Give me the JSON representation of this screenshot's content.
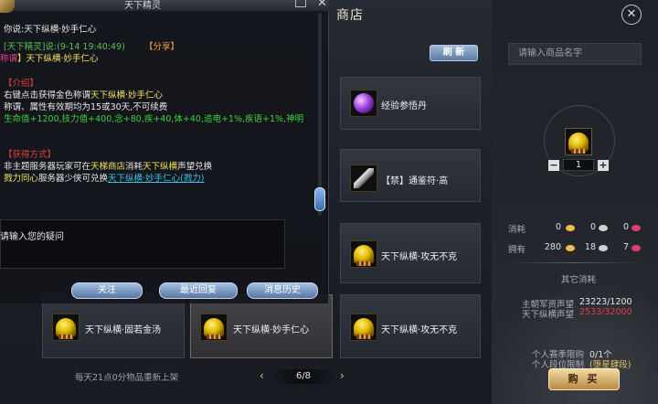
{
  "shop": {
    "title": "商店",
    "close_icon": "close-circle-icon",
    "refresh_label": "刷 新",
    "search_placeholder": "请输入商品名字",
    "footer_note": "每天21点0分物品重新上架",
    "page_indicator": "6/8"
  },
  "items_right": [
    {
      "name": "经验参悟丹",
      "icon": "purple-orb-icon"
    },
    {
      "name": "【禁】通鉴符·高",
      "icon": "feather-icon"
    },
    {
      "name": "天下纵横·攻无不克",
      "icon": "gold-helmet-icon"
    },
    {
      "name": "天下纵横·攻无不克",
      "icon": "gold-helmet-icon"
    }
  ],
  "items_bottom": [
    {
      "name": "天下纵横·固若金汤",
      "icon": "gold-helmet-icon"
    },
    {
      "name": "天下纵横·妙手仁心",
      "icon": "gold-helmet-icon",
      "selected": true
    }
  ],
  "chat": {
    "title": "天下精灵",
    "line_said": "你说:天下纵横·妙手仁心",
    "sender": "[天下精灵]说:(9-14 19:40:49)",
    "share": "【分享】",
    "title_prefix": "称谓",
    "title_item": "】天下纵横·妙手仁心",
    "intro_header": "【介绍】",
    "intro_1_a": "右键点击获得金色称谓",
    "intro_1_b": "天下纵横·妙手仁心",
    "intro_2": "称谓、属性有效期均为15或30天,不可续费",
    "intro_3": "生命值+1200,技力值+400,念+80,疾+40,体+40,追电+1%,疾语+1%,神明",
    "acquire_header": "【获得方式】",
    "acquire_1_a": "非主题服务器玩家可在",
    "acquire_1_b": "天梯商店",
    "acquire_1_c": "消耗",
    "acquire_1_d": "天下纵横",
    "acquire_1_e": "声望兑换",
    "acquire_2_a": "戮力同心",
    "acquire_2_b": "服务器少侠可兑换",
    "acquire_2_c": "天下纵横·妙手仁心(戮力)",
    "input_text": "请输入您的疑问",
    "btn_follow": "关注",
    "btn_recent": "最近回复",
    "btn_history": "消息历史"
  },
  "purchase": {
    "quantity": "1",
    "cost_label": "消耗",
    "cost_values": [
      "0",
      "0",
      "0"
    ],
    "own_label": "拥有",
    "own_values": [
      "280",
      "18",
      "7"
    ],
    "other_cost_header": "其它消耗",
    "rep1_label": "主朝军资声望",
    "rep1_value": "23223/1200",
    "rep2_label": "天下纵横声望",
    "rep2_value": "2533/32000",
    "season_limit_label": "个人赛季限购",
    "season_limit_value": "0/1个",
    "rank_limit_label": "个人段位限制",
    "rank_limit_value": "(堕星肆段)",
    "buy_label": "购 买",
    "colors": {
      "rep2_value": "#e04040",
      "rep1_value": "#e6e6e6",
      "coin_gold": "#e8c24a",
      "coin_silver": "#d0d0d0",
      "coin_red": "#e04070"
    }
  }
}
